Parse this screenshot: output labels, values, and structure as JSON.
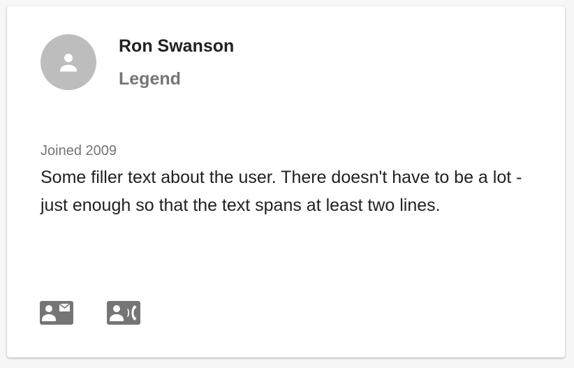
{
  "profile": {
    "name": "Ron Swanson",
    "title": "Legend",
    "joined": "Joined 2009",
    "bio": "Some filler text about the user. There doesn't have to be a lot - just enough so that the text spans at least two lines."
  },
  "icons": {
    "avatar": "person-icon",
    "email": "contact-mail-icon",
    "phone": "contact-phone-icon"
  },
  "colors": {
    "avatar_background": "#bdbdbd",
    "icon_color": "#757575",
    "name_color": "#212121",
    "secondary_text": "#757575"
  }
}
